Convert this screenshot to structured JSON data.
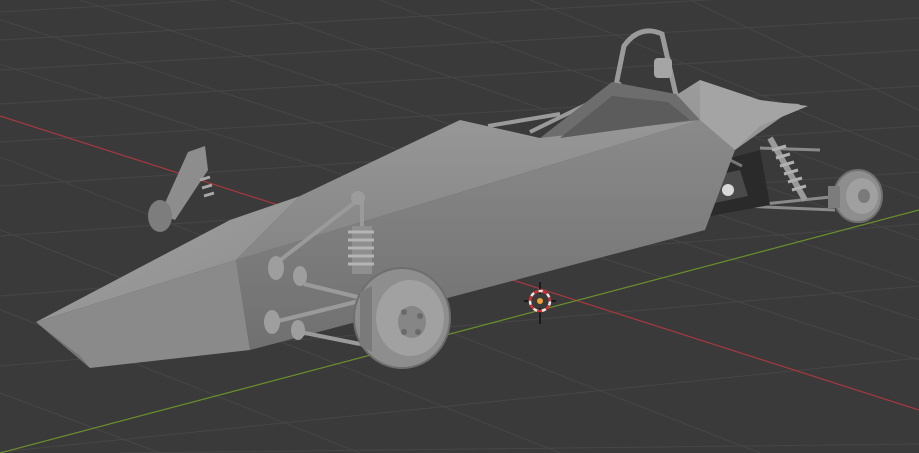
{
  "viewport": {
    "background_color": "#3a3a3a",
    "grid_color": "#474747",
    "x_axis_color": "#a8383f",
    "y_axis_color": "#6a8f2c",
    "model_color": "#8f8f8f",
    "cursor_icon": "3d-cursor-icon"
  }
}
